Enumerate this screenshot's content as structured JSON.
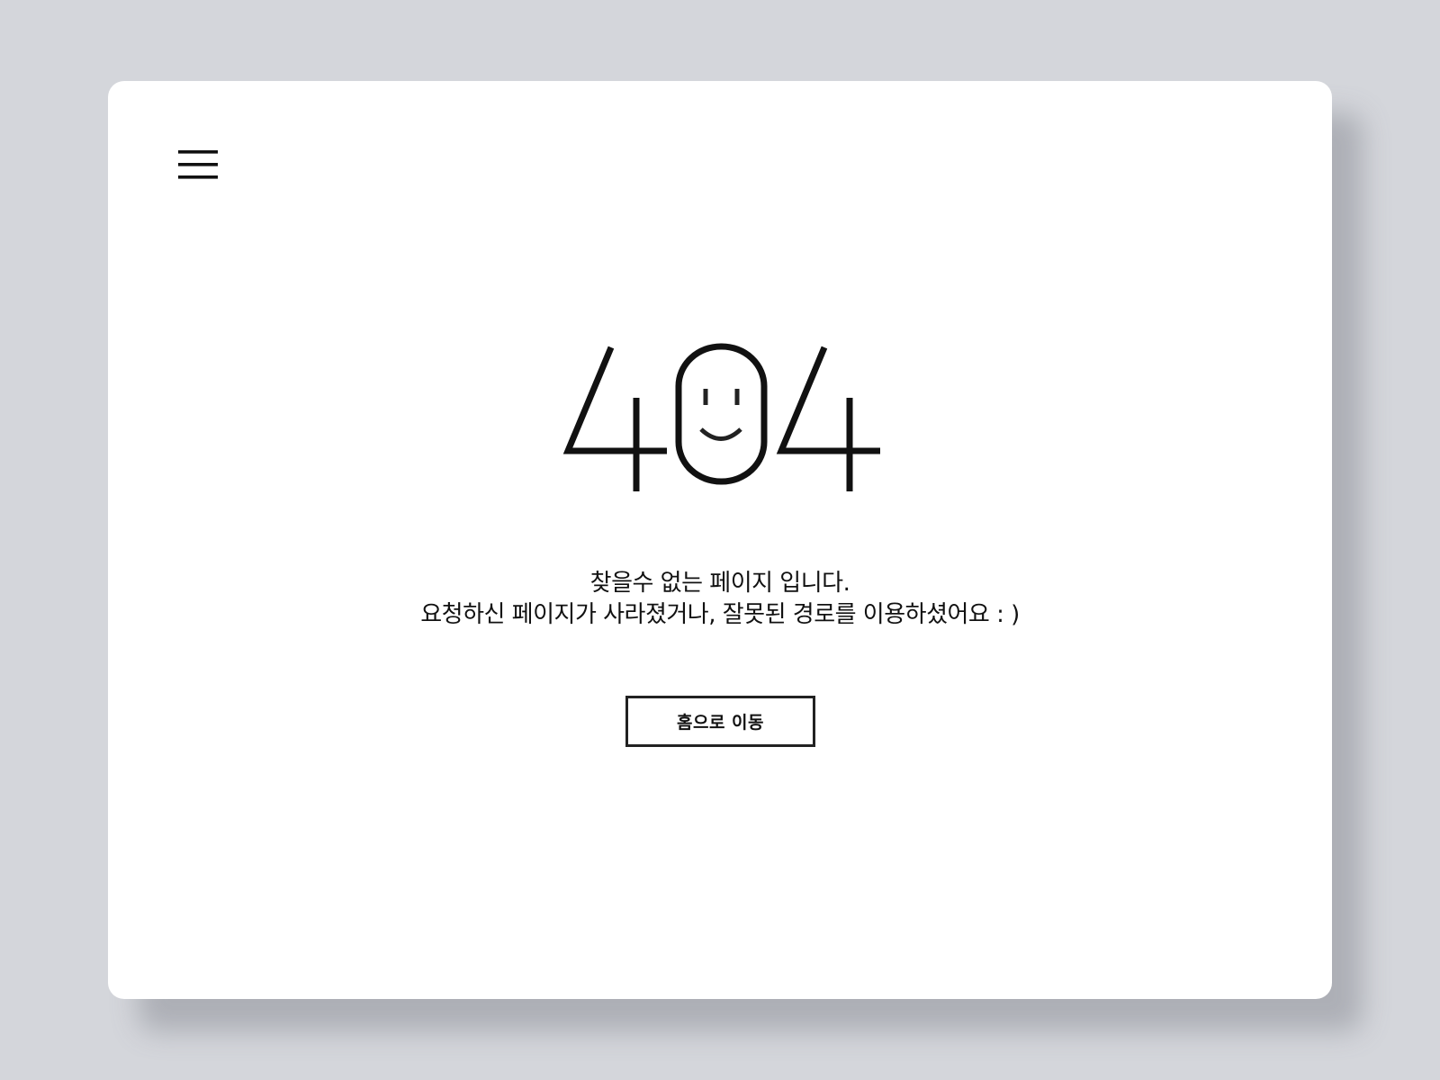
{
  "page": {
    "background_color": "#d4d6db",
    "card_color": "#ffffff",
    "ink_color": "#111111"
  },
  "header": {
    "menu_icon": "hamburger-menu-icon"
  },
  "error": {
    "code": "404",
    "face_icon": "smiley-face-icon",
    "title": "찾을수 없는 페이지 입니다.",
    "description": "요청하신 페이지가 사라졌거나, 잘못된 경로를 이용하셨어요 : )"
  },
  "actions": {
    "home_button_label": "홈으로 이동"
  }
}
